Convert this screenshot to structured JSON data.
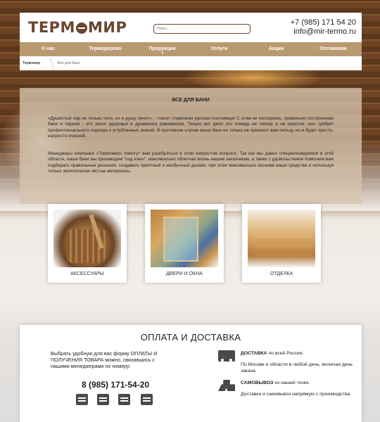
{
  "header": {
    "logo_text_a": "ТЕРМ",
    "logo_text_b": "МИР",
    "search_placeholder": "Поиск...",
    "phone": "+7 (985) 171 54 20",
    "email": "info@mir-termo.ru"
  },
  "nav": {
    "items": [
      "О нас",
      "Термодерево",
      "Продукция",
      "Услуги",
      "Акции",
      "Оптовикам"
    ],
    "dropdown_marker": "▼"
  },
  "breadcrumbs": {
    "home": "Термомир",
    "current": "Все для бани"
  },
  "content": {
    "title": "ВСЕ ДЛЯ БАНИ",
    "paragraph1": "«Душистый пар не только тело, но и душу лечит», - гласит старинная русская пословица! С этим не поспоришь, правильно построенная баня и парная - это залог здоровья и душевного равновесия. Только вот дело это отнюдь не легкое и не простое, оно требует профессионального подхода и углубленных знаний. В противном случае ваша баня не только не принесет вам пользу, но и будет просто-напросто опасной.",
    "paragraph2": "Менеджеры компании «Термомир» помогут вам разобраться в этом непростом вопросе. Так как мы давно специализируемся в этой области, наши бани мы производим \"под ключ\", максимально облегчая жизнь нашим заказчикам, а также с удовольствием помогаем вам подбирать правильные решения, создавать приятный и необычный дизайн, при этом максимально экономя ваши средства и используя только экологически чистые материалы."
  },
  "cards": [
    {
      "label": "АКСЕССУАРЫ",
      "icon": "sauna-accessories-image"
    },
    {
      "label": "ДВЕРИ И ОКНА",
      "icon": "doors-windows-image"
    },
    {
      "label": "ОТДЕЛКА",
      "icon": "finishing-image"
    }
  ],
  "payment": {
    "title": "ОПЛАТА И ДОСТАВКА",
    "left_text": "Выбрать удобную для вас форму ОПЛАТЫ И ПОЛУЧЕНИЯ ТОВАРА можно, связавшись с нашими менеджерами по номеру:",
    "phone": "8 (985) 171-54-20",
    "pay_icons": [
      "wallet-icon",
      "card-icon",
      "invoice-icon",
      "cash-register-icon"
    ],
    "delivery_bold": "ДОСТАВКА",
    "delivery_rest": " по всей России.",
    "delivery_moscow": "По Москве и области в любой день, включая день заказа.",
    "pickup_bold": "САМОВЫВОЗ",
    "pickup_rest": " из нашей точки.",
    "pickup_note": "Доставка и самовывоз напрямую с производства."
  }
}
